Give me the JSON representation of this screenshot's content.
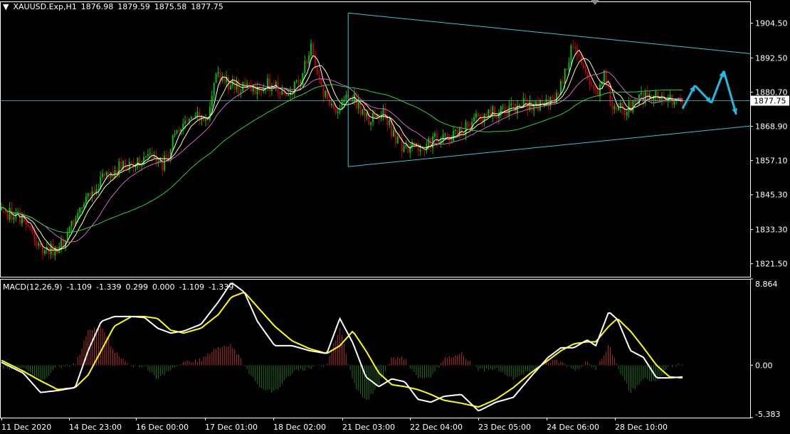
{
  "price_panel": {
    "symbol": "XAUUSD.Exp,H1",
    "open": "1876.98",
    "high": "1879.59",
    "low": "1875.58",
    "close": "1877.75",
    "current_price_label": "1877.75",
    "ask_label": "1880.70"
  },
  "macd_panel": {
    "name": "MACD(12,26,9)",
    "values": [
      "-1.109",
      "-1.339",
      "0.299",
      "0.000",
      "-1.109",
      "-1.339"
    ]
  },
  "colors": {
    "background": "#000000",
    "grid": "#ffffff",
    "bull": "#00c000",
    "bear": "#c00000",
    "ma_fast": "#ffffff",
    "ma_mid": "#ffff99",
    "ma_slow": "#cc66cc",
    "ma_long": "#33cc33",
    "trendline": "#33cccc",
    "projection": "#22bbdd",
    "macd_line": "#ffffff",
    "signal_line": "#ffff00",
    "hist_pos": "#b03030",
    "hist_neg": "#207020"
  },
  "chart_data": [
    {
      "type": "candlestick",
      "title": "XAUUSD.Exp,H1",
      "ylim": [
        1817,
        1912
      ],
      "y_ticks": [
        "1904.50",
        "1892.50",
        "1880.70",
        "1868.90",
        "1857.10",
        "1845.30",
        "1833.30",
        "1821.50"
      ],
      "x_ticks": [
        "11 Dec 2020",
        "14 Dec 23:00",
        "16 Dec 00:00",
        "17 Dec 01:00",
        "18 Dec 02:00",
        "21 Dec 03:00",
        "22 Dec 04:00",
        "23 Dec 05:00",
        "24 Dec 06:00",
        "28 Dec 10:00"
      ],
      "close_path": [
        [
          0,
          1840
        ],
        [
          10,
          1836
        ],
        [
          18,
          1828
        ],
        [
          22,
          1826
        ],
        [
          28,
          1826
        ],
        [
          36,
          1838
        ],
        [
          42,
          1846
        ],
        [
          52,
          1852
        ],
        [
          60,
          1856
        ],
        [
          66,
          1857
        ],
        [
          72,
          1860
        ],
        [
          78,
          1855
        ],
        [
          84,
          1866
        ],
        [
          90,
          1870
        ],
        [
          100,
          1873
        ],
        [
          105,
          1888
        ],
        [
          110,
          1883
        ],
        [
          118,
          1882
        ],
        [
          130,
          1883
        ],
        [
          138,
          1881
        ],
        [
          145,
          1885
        ],
        [
          150,
          1896
        ],
        [
          155,
          1882
        ],
        [
          162,
          1874
        ],
        [
          170,
          1880
        ],
        [
          178,
          1870
        ],
        [
          185,
          1874
        ],
        [
          192,
          1863
        ],
        [
          200,
          1861
        ],
        [
          210,
          1864
        ],
        [
          220,
          1866
        ],
        [
          230,
          1871
        ],
        [
          240,
          1874
        ],
        [
          250,
          1876
        ],
        [
          262,
          1877
        ],
        [
          270,
          1880
        ],
        [
          276,
          1896
        ],
        [
          282,
          1890
        ],
        [
          288,
          1880
        ],
        [
          292,
          1886
        ],
        [
          296,
          1876
        ],
        [
          302,
          1875
        ],
        [
          312,
          1879
        ],
        [
          322,
          1878
        ],
        [
          330,
          1877.75
        ]
      ],
      "triangle": {
        "apex_high": 1908,
        "end_high": 1894,
        "apex_low": 1855,
        "end_low": 1869
      },
      "projection": [
        [
          330,
          1875
        ],
        [
          336,
          1883
        ],
        [
          344,
          1877
        ],
        [
          350,
          1888
        ],
        [
          356,
          1873
        ]
      ]
    },
    {
      "type": "macd",
      "title": "MACD(12,26,9)",
      "ylim": [
        -5.383,
        8.864
      ],
      "y_ticks": [
        "8.864",
        "0.00",
        "-5.383"
      ],
      "macd": [
        [
          0,
          0.3
        ],
        [
          10,
          -0.8
        ],
        [
          18,
          -2.8
        ],
        [
          26,
          -2.6
        ],
        [
          34,
          -2.3
        ],
        [
          40,
          1.5
        ],
        [
          46,
          4.5
        ],
        [
          52,
          5.0
        ],
        [
          60,
          5.0
        ],
        [
          66,
          4.9
        ],
        [
          72,
          3.8
        ],
        [
          78,
          3.3
        ],
        [
          84,
          3.5
        ],
        [
          92,
          4.2
        ],
        [
          100,
          6.5
        ],
        [
          106,
          8.5
        ],
        [
          112,
          7.5
        ],
        [
          118,
          4.5
        ],
        [
          126,
          2.0
        ],
        [
          134,
          2.0
        ],
        [
          142,
          1.5
        ],
        [
          150,
          1.2
        ],
        [
          156,
          4.8
        ],
        [
          162,
          2.3
        ],
        [
          168,
          -1.2
        ],
        [
          174,
          -2.2
        ],
        [
          180,
          -1.4
        ],
        [
          186,
          -1.7
        ],
        [
          192,
          -3.5
        ],
        [
          198,
          -3.8
        ],
        [
          204,
          -3.2
        ],
        [
          212,
          -3.0
        ],
        [
          220,
          -4.7
        ],
        [
          228,
          -3.8
        ],
        [
          236,
          -3.3
        ],
        [
          244,
          -1.2
        ],
        [
          252,
          0.8
        ],
        [
          258,
          1.8
        ],
        [
          264,
          1.8
        ],
        [
          270,
          2.6
        ],
        [
          274,
          2.0
        ],
        [
          280,
          5.5
        ],
        [
          284,
          4.7
        ],
        [
          290,
          1.5
        ],
        [
          296,
          0.8
        ],
        [
          302,
          -1.3
        ],
        [
          308,
          -1.3
        ],
        [
          314,
          -1.2
        ]
      ],
      "signal": [
        [
          0,
          0.5
        ],
        [
          10,
          -0.6
        ],
        [
          18,
          -1.6
        ],
        [
          26,
          -2.5
        ],
        [
          34,
          -2.3
        ],
        [
          40,
          -1.0
        ],
        [
          46,
          1.5
        ],
        [
          52,
          4.0
        ],
        [
          60,
          5.0
        ],
        [
          66,
          5.0
        ],
        [
          72,
          4.8
        ],
        [
          78,
          3.6
        ],
        [
          84,
          3.3
        ],
        [
          92,
          3.8
        ],
        [
          100,
          5.2
        ],
        [
          106,
          7.0
        ],
        [
          112,
          7.5
        ],
        [
          118,
          6.0
        ],
        [
          126,
          4.0
        ],
        [
          134,
          2.5
        ],
        [
          142,
          1.7
        ],
        [
          150,
          1.2
        ],
        [
          156,
          2.0
        ],
        [
          162,
          3.5
        ],
        [
          168,
          1.5
        ],
        [
          174,
          -0.8
        ],
        [
          180,
          -2.0
        ],
        [
          186,
          -2.2
        ],
        [
          192,
          -2.5
        ],
        [
          198,
          -3.0
        ],
        [
          204,
          -3.6
        ],
        [
          212,
          -3.9
        ],
        [
          220,
          -4.3
        ],
        [
          228,
          -3.5
        ],
        [
          236,
          -2.3
        ],
        [
          244,
          -0.8
        ],
        [
          252,
          0.5
        ],
        [
          258,
          1.5
        ],
        [
          264,
          2.2
        ],
        [
          270,
          2.4
        ],
        [
          274,
          2.4
        ],
        [
          280,
          4.0
        ],
        [
          284,
          4.8
        ],
        [
          290,
          3.5
        ],
        [
          296,
          1.8
        ],
        [
          302,
          0.0
        ],
        [
          308,
          -1.2
        ],
        [
          314,
          -1.3
        ]
      ]
    }
  ]
}
